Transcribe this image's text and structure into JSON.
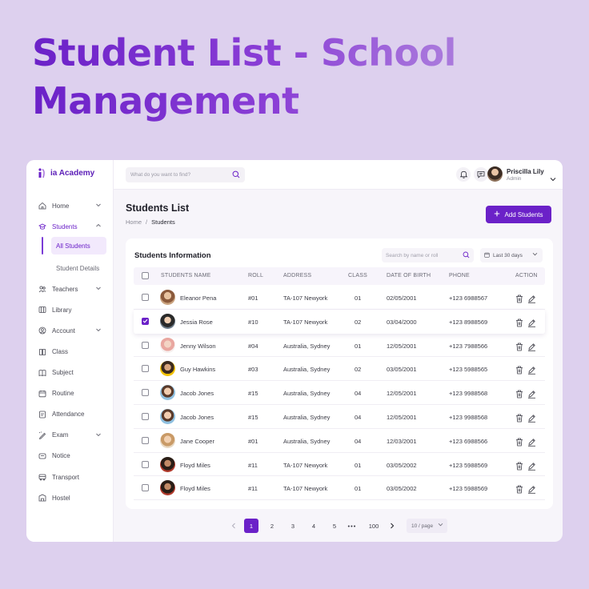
{
  "hero": {
    "title": "Student List - School Management"
  },
  "brand": {
    "name": "ia Academy",
    "accent": "#6b21c8"
  },
  "search_top": {
    "placeholder": "What do you want to find?"
  },
  "user": {
    "name": "Priscilla Lily",
    "role": "Admin"
  },
  "sidebar": {
    "items": [
      {
        "label": "Home",
        "icon": "home-icon",
        "has_chevron": true
      },
      {
        "label": "Students",
        "icon": "students-icon",
        "has_chevron": true,
        "active": true
      },
      {
        "label": "Teachers",
        "icon": "teachers-icon",
        "has_chevron": true
      },
      {
        "label": "Library",
        "icon": "library-icon"
      },
      {
        "label": "Account",
        "icon": "account-icon",
        "has_chevron": true
      },
      {
        "label": "Class",
        "icon": "class-icon"
      },
      {
        "label": "Subject",
        "icon": "subject-icon"
      },
      {
        "label": "Routine",
        "icon": "routine-icon"
      },
      {
        "label": "Attendance",
        "icon": "attendance-icon"
      },
      {
        "label": "Exam",
        "icon": "exam-icon",
        "has_chevron": true
      },
      {
        "label": "Notice",
        "icon": "notice-icon"
      },
      {
        "label": "Transport",
        "icon": "transport-icon"
      },
      {
        "label": "Hostel",
        "icon": "hostel-icon"
      }
    ],
    "sub_items": [
      {
        "label": "All Students",
        "active": true
      },
      {
        "label": "Student Details"
      }
    ]
  },
  "page": {
    "title": "Students List",
    "breadcrumb": [
      "Home",
      "/",
      "Students"
    ],
    "add_button": "Add Students"
  },
  "table": {
    "title": "Students Information",
    "search_placeholder": "Search by  name or roll",
    "date_filter": "Last 30 days",
    "columns": [
      "STUDENTS NAME",
      "ROLL",
      "ADDRESS",
      "CLASS",
      "DATE OF BIRTH",
      "PHONE",
      "ACTION"
    ],
    "rows": [
      {
        "name": "Eleanor Pena",
        "roll": "#01",
        "address": "TA-107 Newyork",
        "class": "01",
        "dob": "02/05/2001",
        "phone": "+123 6988567",
        "checked": false
      },
      {
        "name": "Jessia Rose",
        "roll": "#10",
        "address": "TA-107 Newyork",
        "class": "02",
        "dob": "03/04/2000",
        "phone": "+123 8988569",
        "checked": true
      },
      {
        "name": "Jenny Wilson",
        "roll": "#04",
        "address": "Australia, Sydney",
        "class": "01",
        "dob": "12/05/2001",
        "phone": "+123 7988566",
        "checked": false
      },
      {
        "name": "Guy Hawkins",
        "roll": "#03",
        "address": "Australia, Sydney",
        "class": "02",
        "dob": "03/05/2001",
        "phone": "+123 5988565",
        "checked": false
      },
      {
        "name": "Jacob Jones",
        "roll": "#15",
        "address": "Australia, Sydney",
        "class": "04",
        "dob": "12/05/2001",
        "phone": "+123 9988568",
        "checked": false
      },
      {
        "name": "Jacob Jones",
        "roll": "#15",
        "address": "Australia, Sydney",
        "class": "04",
        "dob": "12/05/2001",
        "phone": "+123 9988568",
        "checked": false
      },
      {
        "name": "Jane Cooper",
        "roll": "#01",
        "address": "Australia, Sydney",
        "class": "04",
        "dob": "12/03/2001",
        "phone": "+123 6988566",
        "checked": false
      },
      {
        "name": "Floyd Miles",
        "roll": "#11",
        "address": "TA-107 Newyork",
        "class": "01",
        "dob": "03/05/2002",
        "phone": "+123 5988569",
        "checked": false
      },
      {
        "name": "Floyd Miles",
        "roll": "#11",
        "address": "TA-107 Newyork",
        "class": "01",
        "dob": "03/05/2002",
        "phone": "+123 5988569",
        "checked": false
      }
    ]
  },
  "pagination": {
    "pages": [
      "1",
      "2",
      "3",
      "4",
      "5"
    ],
    "ellipsis": "•••",
    "last": "100",
    "current": "1",
    "per_page": "10 / page"
  }
}
